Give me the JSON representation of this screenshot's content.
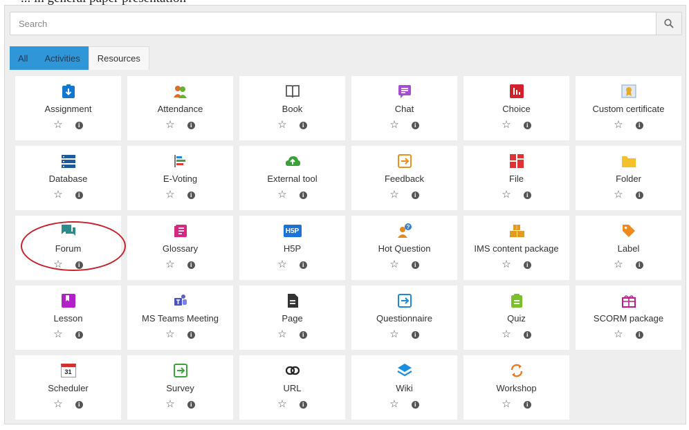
{
  "caption_fragment": "... in general paper presentation",
  "search": {
    "placeholder": "Search"
  },
  "tabs": [
    {
      "label": "All"
    },
    {
      "label": "Activities"
    },
    {
      "label": "Resources"
    }
  ],
  "modules": [
    {
      "name": "Assignment",
      "icon": "assignment-icon"
    },
    {
      "name": "Attendance",
      "icon": "attendance-icon"
    },
    {
      "name": "Book",
      "icon": "book-icon"
    },
    {
      "name": "Chat",
      "icon": "chat-icon"
    },
    {
      "name": "Choice",
      "icon": "choice-icon"
    },
    {
      "name": "Custom certificate",
      "icon": "certificate-icon"
    },
    {
      "name": "Database",
      "icon": "database-icon"
    },
    {
      "name": "E-Voting",
      "icon": "evoting-icon"
    },
    {
      "name": "External tool",
      "icon": "external-tool-icon"
    },
    {
      "name": "Feedback",
      "icon": "feedback-icon"
    },
    {
      "name": "File",
      "icon": "file-icon"
    },
    {
      "name": "Folder",
      "icon": "folder-icon"
    },
    {
      "name": "Forum",
      "icon": "forum-icon"
    },
    {
      "name": "Glossary",
      "icon": "glossary-icon"
    },
    {
      "name": "H5P",
      "icon": "h5p-icon"
    },
    {
      "name": "Hot Question",
      "icon": "hot-question-icon"
    },
    {
      "name": "IMS content package",
      "icon": "ims-package-icon"
    },
    {
      "name": "Label",
      "icon": "label-icon"
    },
    {
      "name": "Lesson",
      "icon": "lesson-icon"
    },
    {
      "name": "MS Teams Meeting",
      "icon": "teams-icon"
    },
    {
      "name": "Page",
      "icon": "page-icon"
    },
    {
      "name": "Questionnaire",
      "icon": "questionnaire-icon"
    },
    {
      "name": "Quiz",
      "icon": "quiz-icon"
    },
    {
      "name": "SCORM package",
      "icon": "scorm-icon"
    },
    {
      "name": "Scheduler",
      "icon": "scheduler-icon"
    },
    {
      "name": "Survey",
      "icon": "survey-icon"
    },
    {
      "name": "URL",
      "icon": "url-icon"
    },
    {
      "name": "Wiki",
      "icon": "wiki-icon"
    },
    {
      "name": "Workshop",
      "icon": "workshop-icon"
    }
  ],
  "h5p_text": "H5P",
  "scheduler_text": "31",
  "colors": {
    "tab_active": "#2f96d8",
    "highlight_circle": "#c8202b"
  }
}
